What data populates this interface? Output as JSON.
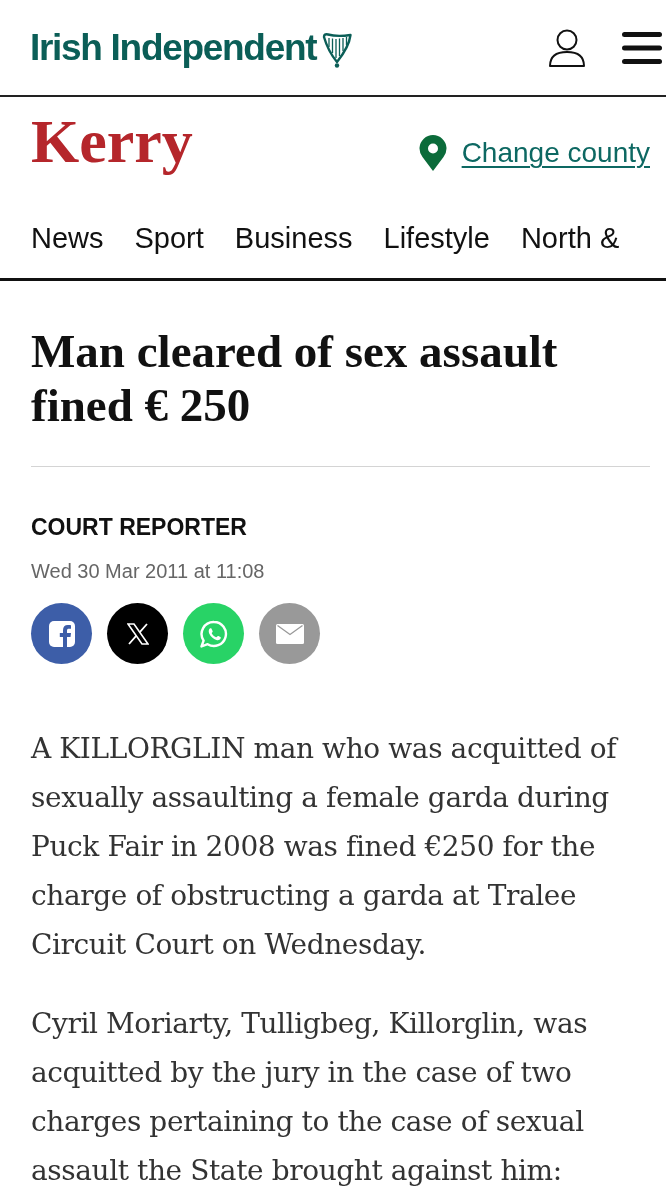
{
  "masthead": {
    "logo": "Irish Independent"
  },
  "county": {
    "name": "Kerry",
    "link": "Change county"
  },
  "nav": {
    "items": [
      "News",
      "Sport",
      "Business",
      "Lifestyle",
      "North &"
    ]
  },
  "article": {
    "headline": "Man cleared of sex assault fined € 250",
    "author": "COURT REPORTER",
    "date": "Wed 30 Mar 2011 at 11:08",
    "share": [
      {
        "kind": "facebook"
      },
      {
        "kind": "x"
      },
      {
        "kind": "whatsapp"
      },
      {
        "kind": "email"
      }
    ],
    "paragraphs": [
      "A KILLORGLIN man who was acquitted of sexually assaulting a female garda during Puck Fair in 2008 was fined €250 for the charge of obstructing a garda at Tralee Circuit Court on Wednesday.",
      "Cyril Moriarty, Tulligbeg, Killorglin, was acquitted by the jury in the case of two charges pertaining to the case of sexual assault the State brought against him:"
    ]
  }
}
